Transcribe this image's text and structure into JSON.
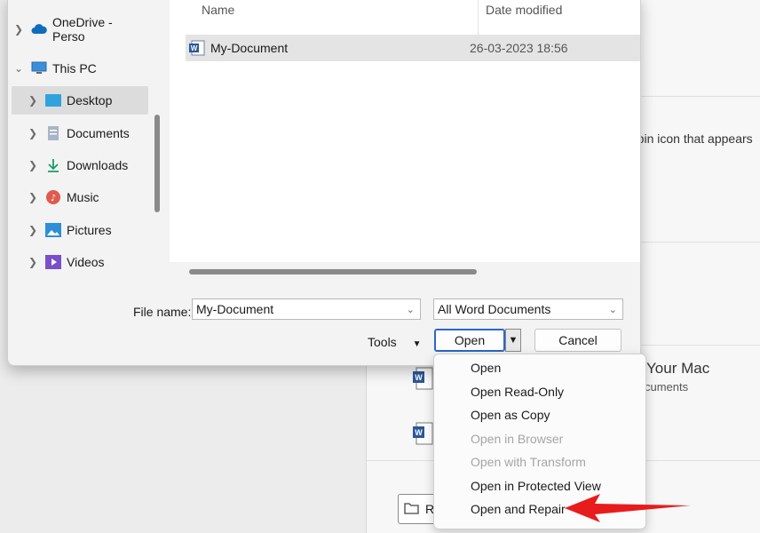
{
  "background": {
    "text_pin": "e pin icon that appears",
    "text_mac": "Your Mac",
    "text_documents": "cuments",
    "browse_letter": "R"
  },
  "nav": {
    "items": [
      {
        "label": "OneDrive - Perso",
        "icon": "onedrive-icon"
      },
      {
        "label": "This PC",
        "icon": "computer-icon"
      },
      {
        "label": "Desktop",
        "icon": "desktop-icon"
      },
      {
        "label": "Documents",
        "icon": "documents-icon"
      },
      {
        "label": "Downloads",
        "icon": "download-icon"
      },
      {
        "label": "Music",
        "icon": "music-icon"
      },
      {
        "label": "Pictures",
        "icon": "pictures-icon"
      },
      {
        "label": "Videos",
        "icon": "videos-icon"
      }
    ]
  },
  "filelist": {
    "columns": {
      "name": "Name",
      "date": "Date modified"
    },
    "rows": [
      {
        "name": "My-Document",
        "date": "26-03-2023 18:56",
        "icon": "word-file-icon"
      }
    ]
  },
  "footer": {
    "filename_label": "File name:",
    "filename_value": "My-Document",
    "filetype": "All Word Documents",
    "tools": "Tools",
    "open": "Open",
    "cancel": "Cancel"
  },
  "menu": {
    "items": [
      {
        "label": "Open",
        "enabled": true
      },
      {
        "label": "Open Read-Only",
        "enabled": true
      },
      {
        "label": "Open as Copy",
        "enabled": true
      },
      {
        "label": "Open in Browser",
        "enabled": false
      },
      {
        "label": "Open with Transform",
        "enabled": false
      },
      {
        "label": "Open in Protected View",
        "enabled": true
      },
      {
        "label": "Open and Repair",
        "enabled": true
      }
    ]
  },
  "colors": {
    "accent": "#2b66c7",
    "arrow": "#e81c1c",
    "word": "#2b579a"
  }
}
